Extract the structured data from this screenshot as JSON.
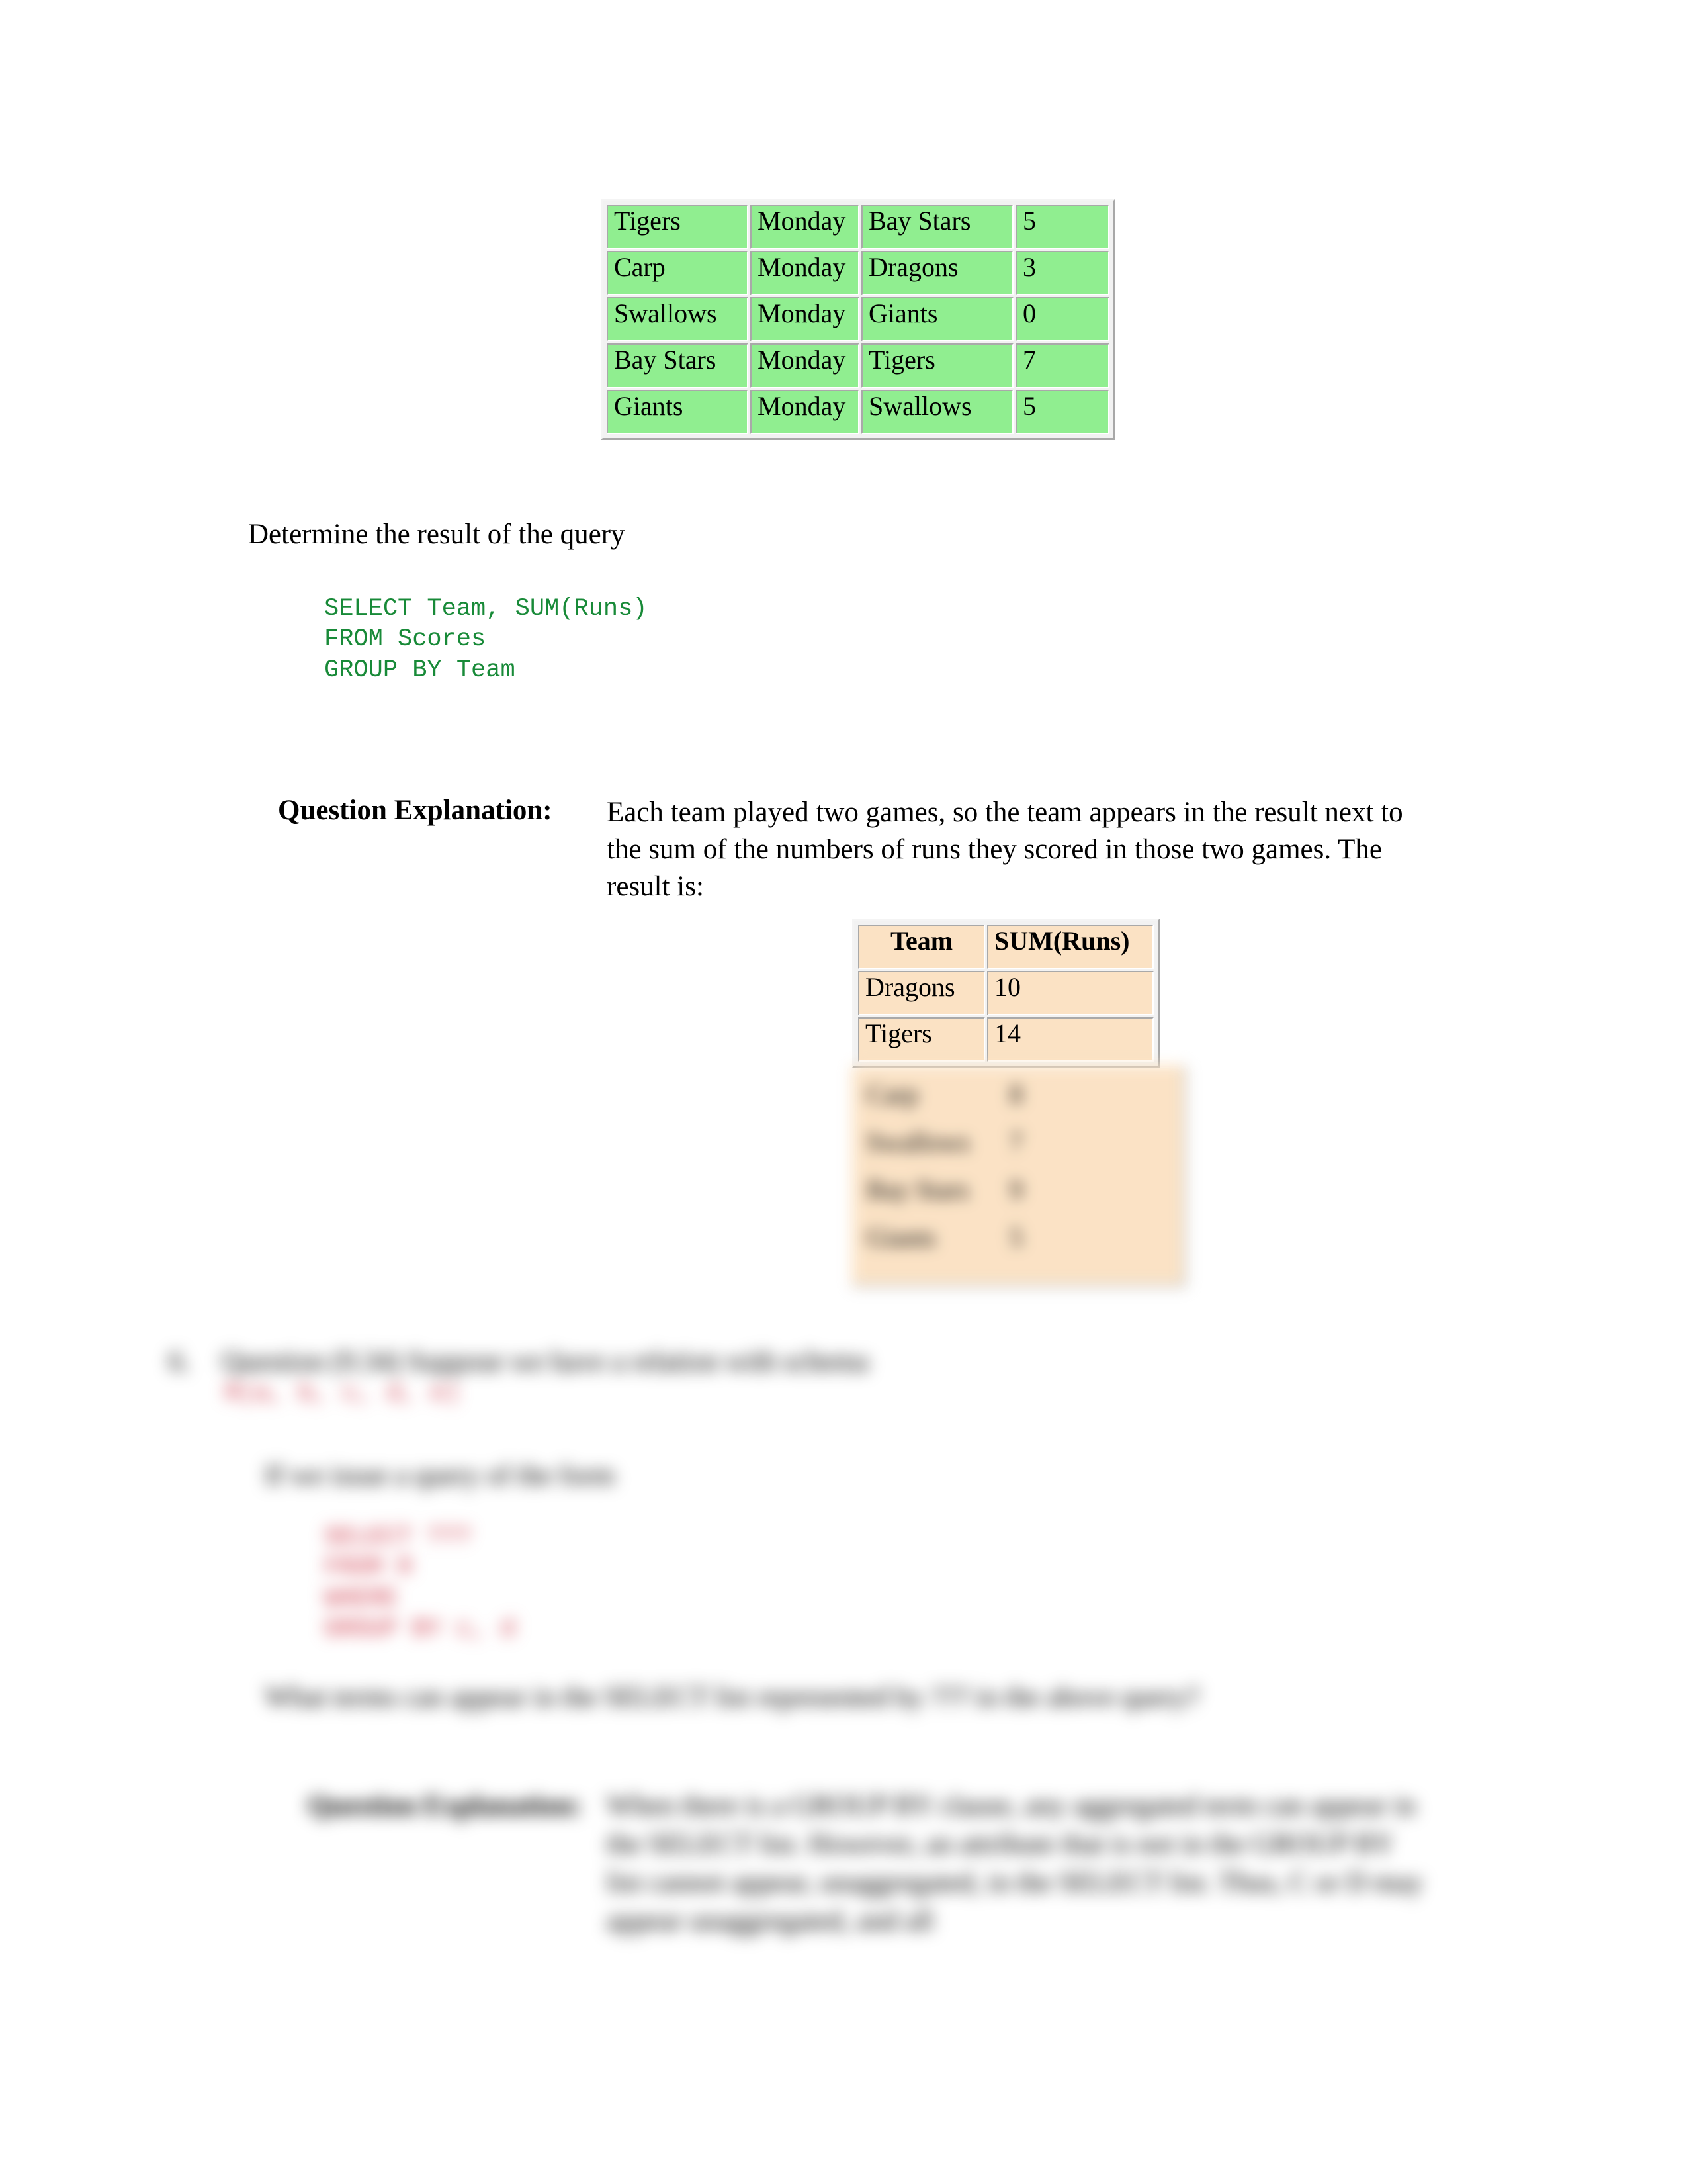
{
  "scores_table": {
    "name": "Scores",
    "rows": [
      [
        "Tigers",
        "Monday",
        "Bay Stars",
        "5"
      ],
      [
        "Carp",
        "Monday",
        "Dragons",
        "3"
      ],
      [
        "Swallows",
        "Monday",
        "Giants",
        "0"
      ],
      [
        "Bay Stars",
        "Monday",
        "Tigers",
        "7"
      ],
      [
        "Giants",
        "Monday",
        "Swallows",
        "5"
      ]
    ]
  },
  "determine": {
    "text": "Determine the result of the query"
  },
  "query": {
    "code": "SELECT Team, SUM(Runs)\nFROM Scores\nGROUP BY Team",
    "color": "#188a38"
  },
  "explanation": {
    "label": "Question Explanation:",
    "body": "Each team played two games, so the team appears in the result next to the sum of the numbers of runs they scored in those two games. The result is:"
  },
  "result_table": {
    "headers": [
      "Team",
      "SUM(Runs)"
    ],
    "rows": [
      [
        "Dragons",
        "10"
      ],
      [
        "Tigers",
        "14"
      ]
    ],
    "blurred_rows": [
      [
        "Carp",
        "8"
      ],
      [
        "Swallows",
        "7"
      ],
      [
        "Bay Stars",
        "9"
      ],
      [
        "Giants",
        "5"
      ]
    ]
  },
  "question6": {
    "marker": "6.",
    "heading": "Question (9.34) Suppose we have a relation with schema",
    "schema": "R(a, b, c, d, e)",
    "form_line": "If we issue a query of the form",
    "code": "SELECT ???\nFROM R\nWHERE\nGROUP BY c, d",
    "ask": "What terms can appear in the SELECT list represented by ??? in the above query?",
    "explanation_label": "Question Explanation:",
    "explanation_body": "When there is a GROUP BY clause, any aggregated term can appear in the SELECT list. However, an attribute that is not in the GROUP BY list cannot appear, unaggregated, in the SELECT list. Thus, C or D may appear unaggregated, and all"
  },
  "colors": {
    "scores_cell": "#90ee90",
    "result_cell": "#fbe2c4",
    "query_green": "#188a38",
    "code_red": "#cc3344",
    "table_border_dark": "#a9a9a9",
    "table_border_light": "#ffffff",
    "page_bg": "#ffffff"
  }
}
